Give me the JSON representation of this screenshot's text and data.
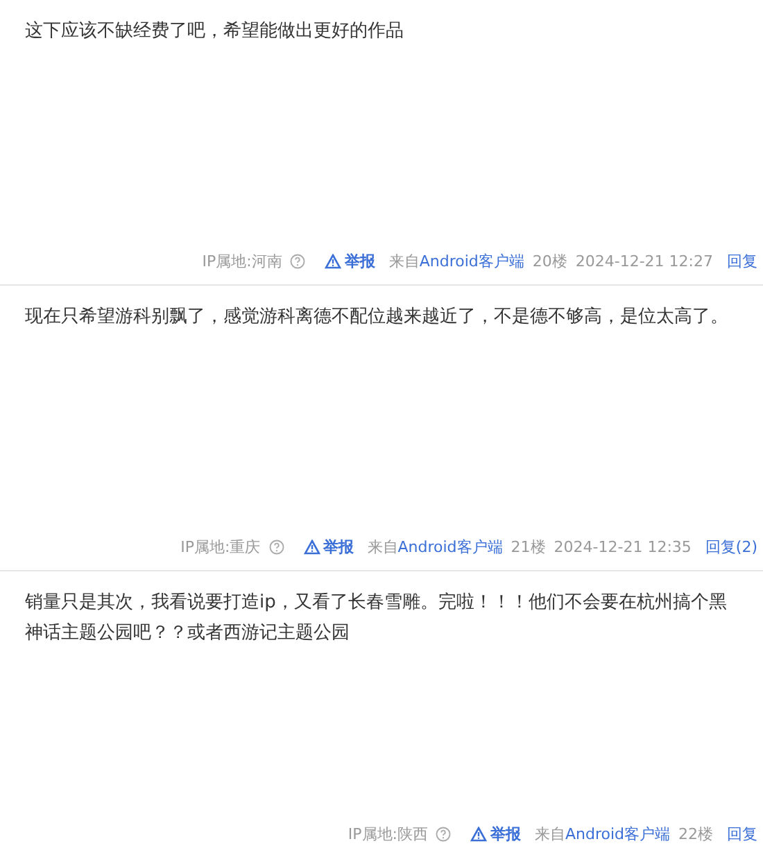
{
  "posts": [
    {
      "content": "这下应该不缺经费了吧，希望能做出更好的作品",
      "ip": "IP属地:河南",
      "report": "举报",
      "from": "来自",
      "client": "Android客户端",
      "floor": "20楼",
      "time": "2024-12-21 12:27",
      "reply": "回复"
    },
    {
      "content": "现在只希望游科别飘了，感觉游科离德不配位越来越近了，不是德不够高，是位太高了。",
      "ip": "IP属地:重庆",
      "report": "举报",
      "from": "来自",
      "client": "Android客户端",
      "floor": "21楼",
      "time": "2024-12-21 12:35",
      "reply": "回复(2)"
    },
    {
      "content": "销量只是其次，我看说要打造ip，又看了长春雪雕。完啦！！！他们不会要在杭州搞个黑神话主题公园吧？？或者西游记主题公园",
      "ip": "IP属地:陕西",
      "report": "举报",
      "from": "来自",
      "client": "Android客户端",
      "floor": "22楼",
      "reply": "回复"
    }
  ]
}
